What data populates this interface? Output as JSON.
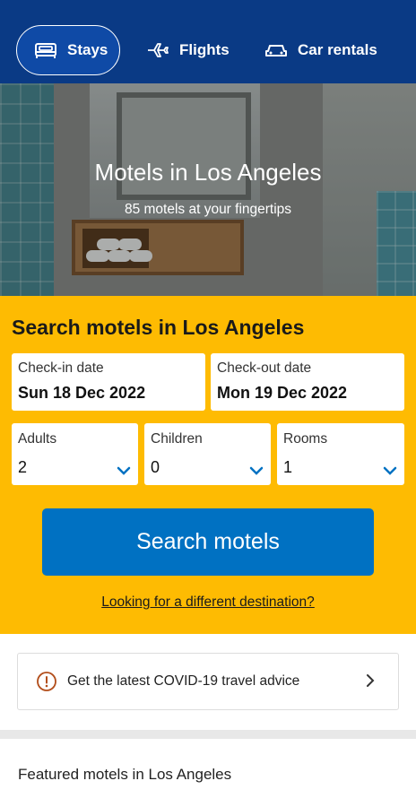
{
  "nav": {
    "tabs": [
      {
        "label": "Stays",
        "icon": "bed-icon",
        "active": true
      },
      {
        "label": "Flights",
        "icon": "plane-icon",
        "active": false
      },
      {
        "label": "Car rentals",
        "icon": "car-icon",
        "active": false
      }
    ]
  },
  "hero": {
    "title": "Motels in Los Angeles",
    "subtitle": "85 motels at your fingertips"
  },
  "search": {
    "title": "Search motels in Los Angeles",
    "checkin": {
      "label": "Check-in date",
      "value": "Sun 18 Dec 2022"
    },
    "checkout": {
      "label": "Check-out date",
      "value": "Mon 19 Dec 2022"
    },
    "adults": {
      "label": "Adults",
      "value": "2"
    },
    "children": {
      "label": "Children",
      "value": "0"
    },
    "rooms": {
      "label": "Rooms",
      "value": "1"
    },
    "button_label": "Search motels",
    "different_destination": "Looking for a different destination?"
  },
  "covid": {
    "text": "Get the latest COVID-19 travel advice",
    "icon": "info-icon"
  },
  "featured": {
    "title": "Featured motels in Los Angeles"
  },
  "colors": {
    "nav_bg": "#0a3a85",
    "search_bg": "#febb02",
    "primary": "#0071c2"
  }
}
